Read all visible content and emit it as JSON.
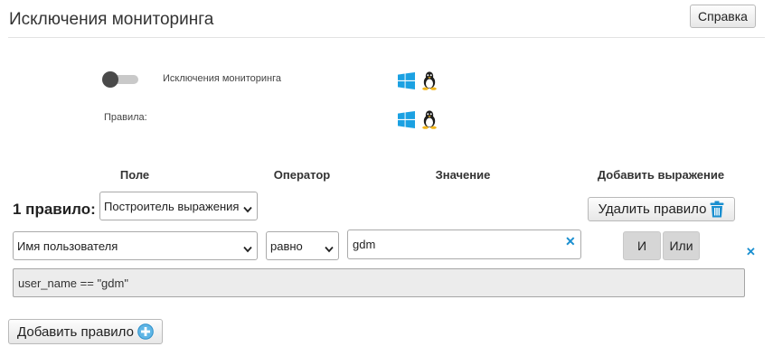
{
  "header": {
    "title": "Исключения мониторинга",
    "help_label": "Справка"
  },
  "settings": {
    "toggle_label": "Исключения мониторинга",
    "toggle_state": "off",
    "rules_label": "Правила:",
    "os_icons": [
      "windows-icon",
      "linux-icon"
    ]
  },
  "columns": {
    "field": "Поле",
    "operator": "Оператор",
    "value": "Значение",
    "add_expression": "Добавить выражение"
  },
  "rule": {
    "count_label": "1 правило:",
    "builder_select": "Построитель выражения",
    "delete_label": "Удалить правило",
    "field_select": "Имя пользователя",
    "operator_select": "равно",
    "value_input": "gdm",
    "and_label": "И",
    "or_label": "Или",
    "expression": "user_name == \"gdm\""
  },
  "footer": {
    "add_rule_label": "Добавить правило"
  },
  "colors": {
    "windows_blue": "#1ba1e2",
    "accent_blue": "#1a8fd0"
  }
}
